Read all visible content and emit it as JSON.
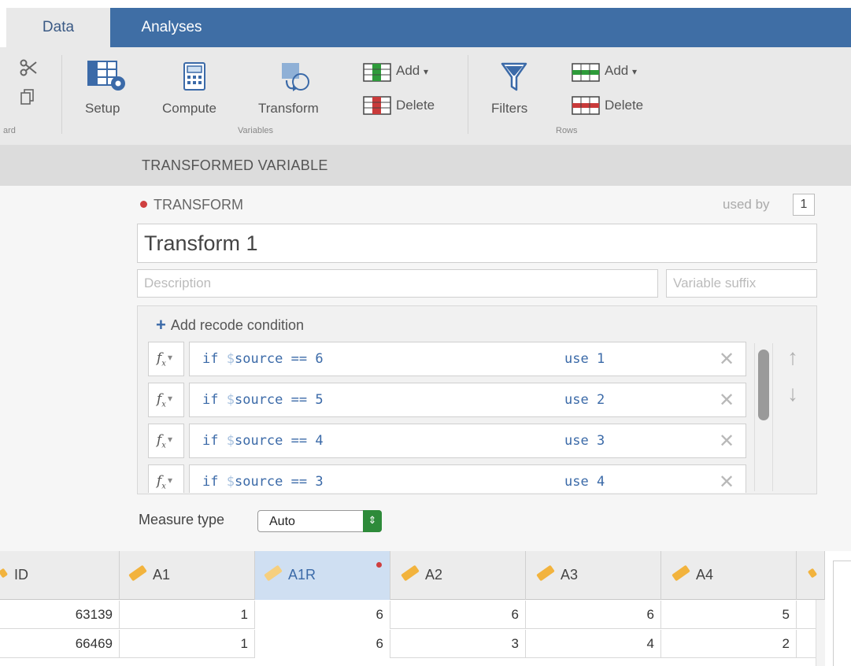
{
  "tabs": {
    "active": "Data",
    "inactive": "Analyses"
  },
  "ribbon": {
    "clipboard_caption": "ard",
    "variables": {
      "setup": "Setup",
      "compute": "Compute",
      "transform": "Transform",
      "add": "Add",
      "delete": "Delete",
      "caption": "Variables"
    },
    "rows": {
      "filters": "Filters",
      "add": "Add",
      "delete": "Delete",
      "caption": "Rows"
    }
  },
  "section_title": "TRANSFORMED VARIABLE",
  "transform": {
    "label": "TRANSFORM",
    "used_by_label": "used by",
    "used_by_count": "1",
    "name": "Transform 1",
    "description_placeholder": "Description",
    "suffix_placeholder": "Variable suffix",
    "add_condition": "Add recode condition",
    "conditions": [
      {
        "fx": "f",
        "if_kw": "if",
        "sym": "$",
        "var": "source",
        "op": "==",
        "value": "6",
        "use_kw": "use",
        "result": "1"
      },
      {
        "fx": "f",
        "if_kw": "if",
        "sym": "$",
        "var": "source",
        "op": "==",
        "value": "5",
        "use_kw": "use",
        "result": "2"
      },
      {
        "fx": "f",
        "if_kw": "if",
        "sym": "$",
        "var": "source",
        "op": "==",
        "value": "4",
        "use_kw": "use",
        "result": "3"
      },
      {
        "fx": "f",
        "if_kw": "if",
        "sym": "$",
        "var": "source",
        "op": "==",
        "value": "3",
        "use_kw": "use",
        "result": "4"
      }
    ],
    "measure_type_label": "Measure type",
    "measure_type_value": "Auto"
  },
  "sheet": {
    "columns": [
      "ID",
      "A1",
      "A1R",
      "A2",
      "A3",
      "A4"
    ],
    "rows": [
      [
        "63139",
        "1",
        "6",
        "6",
        "6",
        "5"
      ],
      [
        "66469",
        "1",
        "6",
        "3",
        "4",
        "2"
      ]
    ]
  },
  "colors": {
    "tab_bar": "#3f6ea5",
    "accent_blue": "#3b6aa8",
    "changed_red": "#cf3f3f",
    "select_green": "#2e8b3a",
    "nominal_pencil": "#f2b33d"
  }
}
